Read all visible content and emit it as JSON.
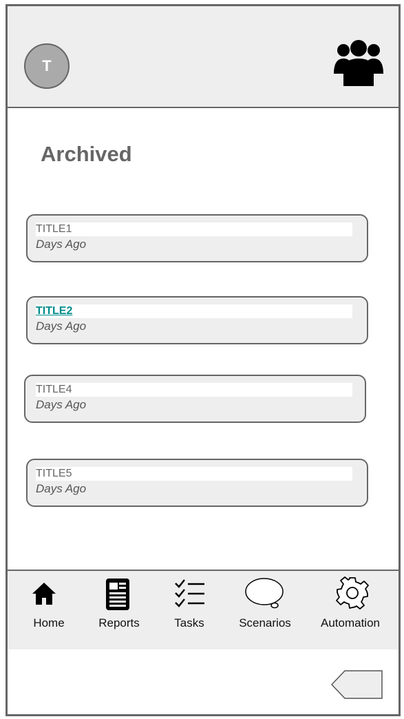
{
  "header": {
    "avatar_initial": "T",
    "group_icon": "group-people-icon"
  },
  "page": {
    "title": "Archived"
  },
  "cards": [
    {
      "title": "TITLE1",
      "subtitle": "Days Ago",
      "selected": false
    },
    {
      "title": "TITLE2",
      "subtitle": "Days Ago",
      "selected": true
    },
    {
      "title": "TITLE4",
      "subtitle": "Days Ago",
      "selected": false
    },
    {
      "title": "TITLE5",
      "subtitle": "Days Ago",
      "selected": false
    }
  ],
  "nav": {
    "items": [
      {
        "label": "Home",
        "icon": "home-icon"
      },
      {
        "label": "Reports",
        "icon": "document-icon"
      },
      {
        "label": "Tasks",
        "icon": "checklist-icon"
      },
      {
        "label": "Scenarios",
        "icon": "speech-bubble-icon"
      },
      {
        "label": "Automation",
        "icon": "gear-icon"
      }
    ]
  },
  "footer": {
    "back_icon": "back-arrow-icon"
  },
  "colors": {
    "frame": "#666666",
    "panel": "#eeeeee",
    "link": "#008b8b",
    "avatar": "#aaaaaa"
  }
}
